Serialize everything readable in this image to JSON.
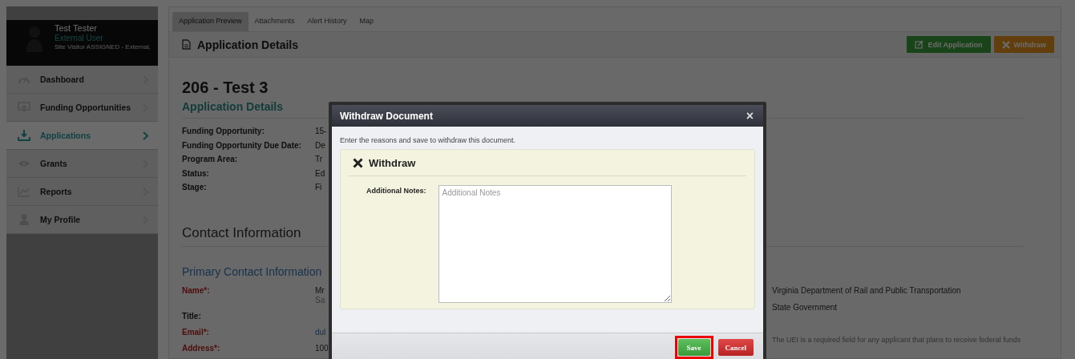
{
  "user": {
    "name": "Test Tester",
    "role": "External User",
    "assignment": "Site Visitor ASSIGNED - External,"
  },
  "sidebar": {
    "items": [
      {
        "label": "Dashboard",
        "selected": false
      },
      {
        "label": "Funding Opportunities",
        "selected": false
      },
      {
        "label": "Applications",
        "selected": true
      },
      {
        "label": "Grants",
        "selected": false
      },
      {
        "label": "Reports",
        "selected": false
      },
      {
        "label": "My Profile",
        "selected": false
      }
    ]
  },
  "tabs": [
    {
      "label": "Application Preview",
      "selected": true
    },
    {
      "label": "Attachments",
      "selected": false
    },
    {
      "label": "Alert History",
      "selected": false
    },
    {
      "label": "Map",
      "selected": false
    }
  ],
  "header": {
    "title": "Application Details",
    "buttons": [
      {
        "label": "Edit Application",
        "kind": "edit"
      },
      {
        "label": "Withdraw",
        "kind": "withdraw"
      }
    ]
  },
  "application": {
    "title": "206 - Test 3",
    "subtitle": "Application Details",
    "fields": [
      {
        "label": "Funding Opportunity:",
        "value": "15-"
      },
      {
        "label": "Funding Opportunity Due Date:",
        "value": "De"
      },
      {
        "label": "Program Area:",
        "value": "Tr"
      },
      {
        "label": "Status:",
        "value": "Ed"
      },
      {
        "label": "Stage:",
        "value": "Fi"
      }
    ]
  },
  "contact": {
    "title": "Contact Information",
    "subtitle": "Primary Contact Information",
    "fields": [
      {
        "label": "Name*:",
        "required": true,
        "kind": "text",
        "values": [
          "Mr",
          "Sa"
        ]
      },
      {
        "label": "Title:",
        "required": false
      },
      {
        "label": "Email*:",
        "required": true,
        "kind": "email",
        "values": [
          "dul"
        ]
      },
      {
        "label": "Address*:",
        "required": true,
        "kind": "text",
        "values": [
          "100"
        ]
      }
    ],
    "side": [
      "Virginia Department of Rail and Public Transportation",
      "State Government"
    ],
    "note": "The UEI is a required field for any applicant that plans to receive federal funds"
  },
  "modal": {
    "title": "Withdraw Document",
    "close": "×",
    "intro": "Enter the reasons and save to withdraw this document.",
    "section": "Withdraw",
    "notes_label": "Additional Notes:",
    "notes_placeholder": "Additional Notes",
    "buttons": [
      {
        "label": "Save",
        "kind": "save",
        "highlighted": true
      },
      {
        "label": "Cancel",
        "kind": "cancel",
        "highlighted": false
      }
    ]
  }
}
